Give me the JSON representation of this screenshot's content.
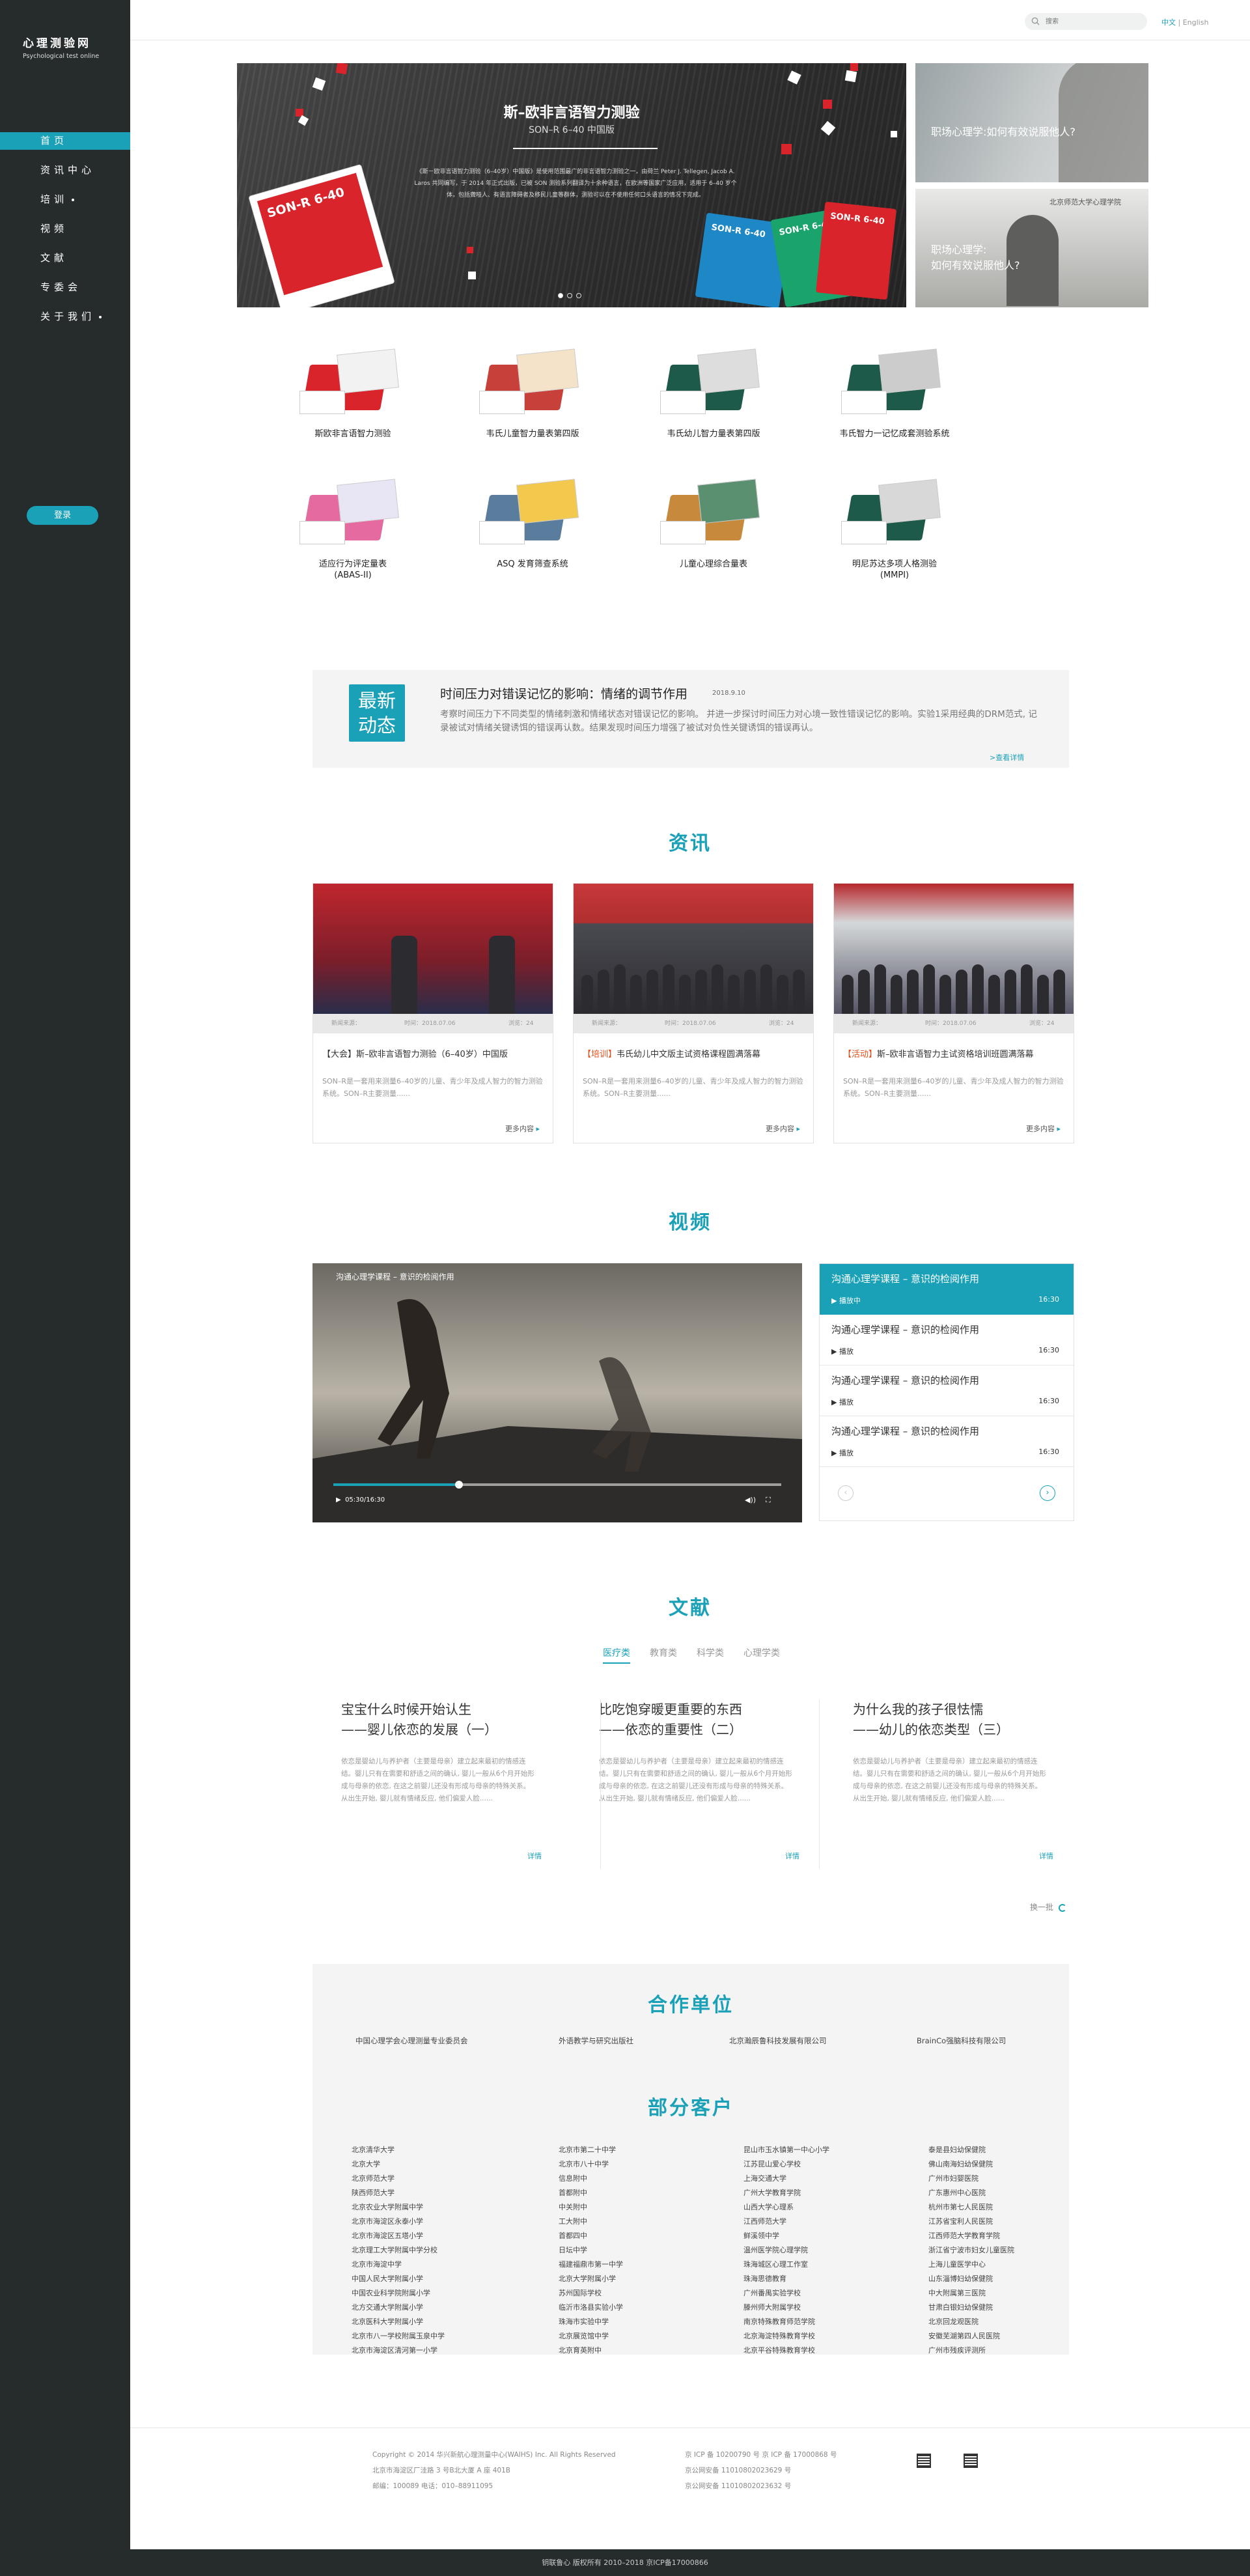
{
  "brand": {
    "name": "心理测验网",
    "tagline": "Psychological test online"
  },
  "nav": [
    {
      "label": "首页",
      "active": true,
      "has_dot": false
    },
    {
      "label": "资讯中心",
      "active": false,
      "has_dot": false
    },
    {
      "label": "培训",
      "active": false,
      "has_dot": true
    },
    {
      "label": "视频",
      "active": false,
      "has_dot": false
    },
    {
      "label": "文献",
      "active": false,
      "has_dot": false
    },
    {
      "label": "专委会",
      "active": false,
      "has_dot": false
    },
    {
      "label": "关于我们",
      "active": false,
      "has_dot": true
    }
  ],
  "login_label": "登录",
  "search": {
    "placeholder": "搜索"
  },
  "lang": {
    "current": "中文",
    "separator": " | ",
    "other": "English"
  },
  "banner": {
    "title": "斯–欧非言语智力测验",
    "subtitle": "SON–R 6–40 中国版",
    "description": "《斯－欧非言语智力测验（6–40岁）中国版》是使用范围最广的非言语智力测验之一，由荷兰 Peter J. Tellegen, Jacob A. Laros 共同编写，于 2014 年正式出版，已被 SON 测验系列翻译为十余种语言，在欧洲等国家广泛应用，适用于 6–40 岁个体，包括聋哑人、有语言障碍者及移民儿童等群体，测验可以在不使用任何口头语言的情况下完成。",
    "book_label": "SON-R 6-40",
    "slides": 3,
    "active_slide": 0
  },
  "side_cards": [
    {
      "caption": "职场心理学:如何有效说服他人?"
    },
    {
      "caption": "职场心理学:\n如何有效说服他人?",
      "sign": "北京师范大学心理学院"
    }
  ],
  "products": [
    {
      "name": "斯欧非言语智力测验"
    },
    {
      "name": "韦氏儿童智力量表第四版"
    },
    {
      "name": "韦氏幼儿智力量表第四版"
    },
    {
      "name": "韦氏智力一记忆成套测验系统"
    },
    {
      "name": "适应行为评定量表\n(ABAS-II)"
    },
    {
      "name": "ASQ 发育筛查系统"
    },
    {
      "name": "儿童心理综合量表"
    },
    {
      "name": "明尼苏达多项人格测验\n(MMPI)"
    }
  ],
  "latest": {
    "badge": "最新\n动态",
    "title": "时间压力对错误记忆的影响：情绪的调节作用",
    "date": "2018.9.10",
    "text": "考察时间压力下不同类型的情绪刺激和情绪状态对错误记忆的影响。 并进一步探讨时间压力对心境一致性错误记忆的影响。实验1采用经典的DRM范式, 记录被试对情绪关键诱饵的错误再认数。结果发现时间压力增强了被试对负性关键诱饵的错误再认。",
    "more": ">查看详情"
  },
  "info": {
    "title": "资讯",
    "cards": [
      {
        "meta_src": "新闻来源：",
        "meta_time": "时间：2018.07.06",
        "meta_views": "浏览：24",
        "tag": "",
        "title": "【大会】斯–欧非言语智力测验（6–40岁）中国版",
        "desc": "SON–R是一套用来测量6–40岁的儿童、青少年及成人智力的智力测验系统。SON–R主要测量......",
        "more": "更多内容"
      },
      {
        "meta_src": "新闻来源：",
        "meta_time": "时间：2018.07.06",
        "meta_views": "浏览：24",
        "tag": "【培训】",
        "title": "韦氏幼儿中文版主试资格课程圆满落幕",
        "desc": "SON–R是一套用来测量6–40岁的儿童、青少年及成人智力的智力测验系统。SON–R主要测量......",
        "more": "更多内容"
      },
      {
        "meta_src": "新闻来源：",
        "meta_time": "时间：2018.07.06",
        "meta_views": "浏览：24",
        "tag": "【活动】",
        "title": "斯–欧非言语智力主试资格培训班圆满落幕",
        "desc": "SON–R是一套用来测量6–40岁的儿童、青少年及成人智力的智力测验系统。SON–R主要测量......",
        "more": "更多内容"
      }
    ]
  },
  "video": {
    "title": "视频",
    "player_title": "沟通心理学课程 – 意识的检阅作用",
    "time": "05:30/16:30",
    "progress": 0.28,
    "playlist": [
      {
        "title": "沟通心理学课程 – 意识的检阅作用",
        "state": "播放中",
        "duration": "16:30",
        "active": true
      },
      {
        "title": "沟通心理学课程 – 意识的检阅作用",
        "state": "播放",
        "duration": "16:30",
        "active": false
      },
      {
        "title": "沟通心理学课程 – 意识的检阅作用",
        "state": "播放",
        "duration": "16:30",
        "active": false
      },
      {
        "title": "沟通心理学课程 – 意识的检阅作用",
        "state": "播放",
        "duration": "16:30",
        "active": false
      }
    ]
  },
  "literature": {
    "title": "文献",
    "tabs": [
      "医疗类",
      "教育类",
      "科学类",
      "心理学类"
    ],
    "active_tab": 0,
    "items": [
      {
        "title": "宝宝什么时候开始认生\n——婴儿依恋的发展（一）",
        "desc": "依恋是婴幼儿与养护者（主要是母亲）建立起来最初的情感连结。婴儿只有在需要和舒适之间的确认, 婴儿一般从6个月开始形成与母亲的依恋, 在这之前婴儿还没有形成与母亲的特殊关系。从出生开始, 婴儿就有情绪反应, 他们偏爱人脸......",
        "more": "详情"
      },
      {
        "title": "比吃饱穿暖更重要的东西\n——依恋的重要性（二）",
        "desc": "依恋是婴幼儿与养护者（主要是母亲）建立起来最初的情感连结。婴儿只有在需要和舒适之间的确认, 婴儿一般从6个月开始形成与母亲的依恋, 在这之前婴儿还没有形成与母亲的特殊关系。从出生开始, 婴儿就有情绪反应, 他们偏爱人脸......",
        "more": "详情"
      },
      {
        "title": "为什么我的孩子很怯懦\n——幼儿的依恋类型（三）",
        "desc": "依恋是婴幼儿与养护者（主要是母亲）建立起来最初的情感连结。婴儿只有在需要和舒适之间的确认, 婴儿一般从6个月开始形成与母亲的依恋, 在这之前婴儿还没有形成与母亲的特殊关系。从出生开始, 婴儿就有情绪反应, 他们偏爱人脸......",
        "more": "详情"
      }
    ],
    "refresh": "换一批"
  },
  "partners": {
    "title": "合作单位",
    "items": [
      "中国心理学会心理测量专业委员会",
      "外语教学与研究出版社",
      "北京瀚辰鲁科技发展有限公司",
      "BrainCo强脑科技有限公司"
    ]
  },
  "clients": {
    "title": "部分客户",
    "columns": [
      [
        "北京清华大学",
        "北京大学",
        "北京师范大学",
        "陕西师范大学",
        "北京农业大学附属中学",
        "北京市海淀区永泰小学",
        "北京市海淀区五塔小学",
        "北京理工大学附属中学分校",
        "北京市海淀中学",
        "中国人民大学附属小学",
        "中国农业科学院附属小学",
        "北方交通大学附属小学",
        "北京医科大学附属小学",
        "北京市八一学校附属玉泉中学",
        "北京市海淀区清河第一小学"
      ],
      [
        "北京市第二十中学",
        "北京市八十中学",
        "信息附中",
        "首都附中",
        "中关附中",
        "工大附中",
        "首都四中",
        "日坛中学",
        "福建福鼎市第一中学",
        "北京大学附属小学",
        "苏州国际学校",
        "临沂市洛县实验小学",
        "珠海市实验中学",
        "北京展览馆中学",
        "北京育英附中"
      ],
      [
        "昆山市玉水镇第一中心小学",
        "江苏昆山爱心学校",
        "上海交通大学",
        "广州大学教育学院",
        "山西大学心理系",
        "江西师范大学",
        "鲜溪领中学",
        "温州医学院心理学院",
        "珠海城区心理工作室",
        "珠海思德教育",
        "广州番禺实验学校",
        "滕州师大附属学校",
        "南京特殊教育师范学院",
        "北京海淀特殊教育学校",
        "北京平谷特殊教育学校"
      ],
      [
        "泰是县妇幼保健院",
        "佛山南海妇幼保健院",
        "广州市妇婴医院",
        "广东惠州中心医院",
        "杭州市第七人民医院",
        "江苏省宝利人民医院",
        "江西师范大学教育学院",
        "浙江省宁波市妇女儿童医院",
        "上海儿童医学中心",
        "山东淄博妇幼保健院",
        "中大附属第三医院",
        "甘肃白银妇幼保健院",
        "北京回龙观医院",
        "安徽芜湖第四人民医院",
        "广州市残疾评测所"
      ]
    ]
  },
  "footer": {
    "copyright": "Copyright © 2014 华兴新航心理测量中心(WAIHS) Inc. All Rights Reserved",
    "address": "北京市海淀区厂洼路 3 号B北大厦 A 座 401B",
    "contact": "邮编：100089  电话：010–88911095",
    "icp1": "京 ICP 备 10200790 号  京 ICP 备 17000868 号",
    "icp2": "京公网安备 11010802023629 号",
    "icp3": "京公网安备 11010802023632 号",
    "bottom": "钥联鲁心 版权所有 2010–2018 京ICP备17000866"
  }
}
